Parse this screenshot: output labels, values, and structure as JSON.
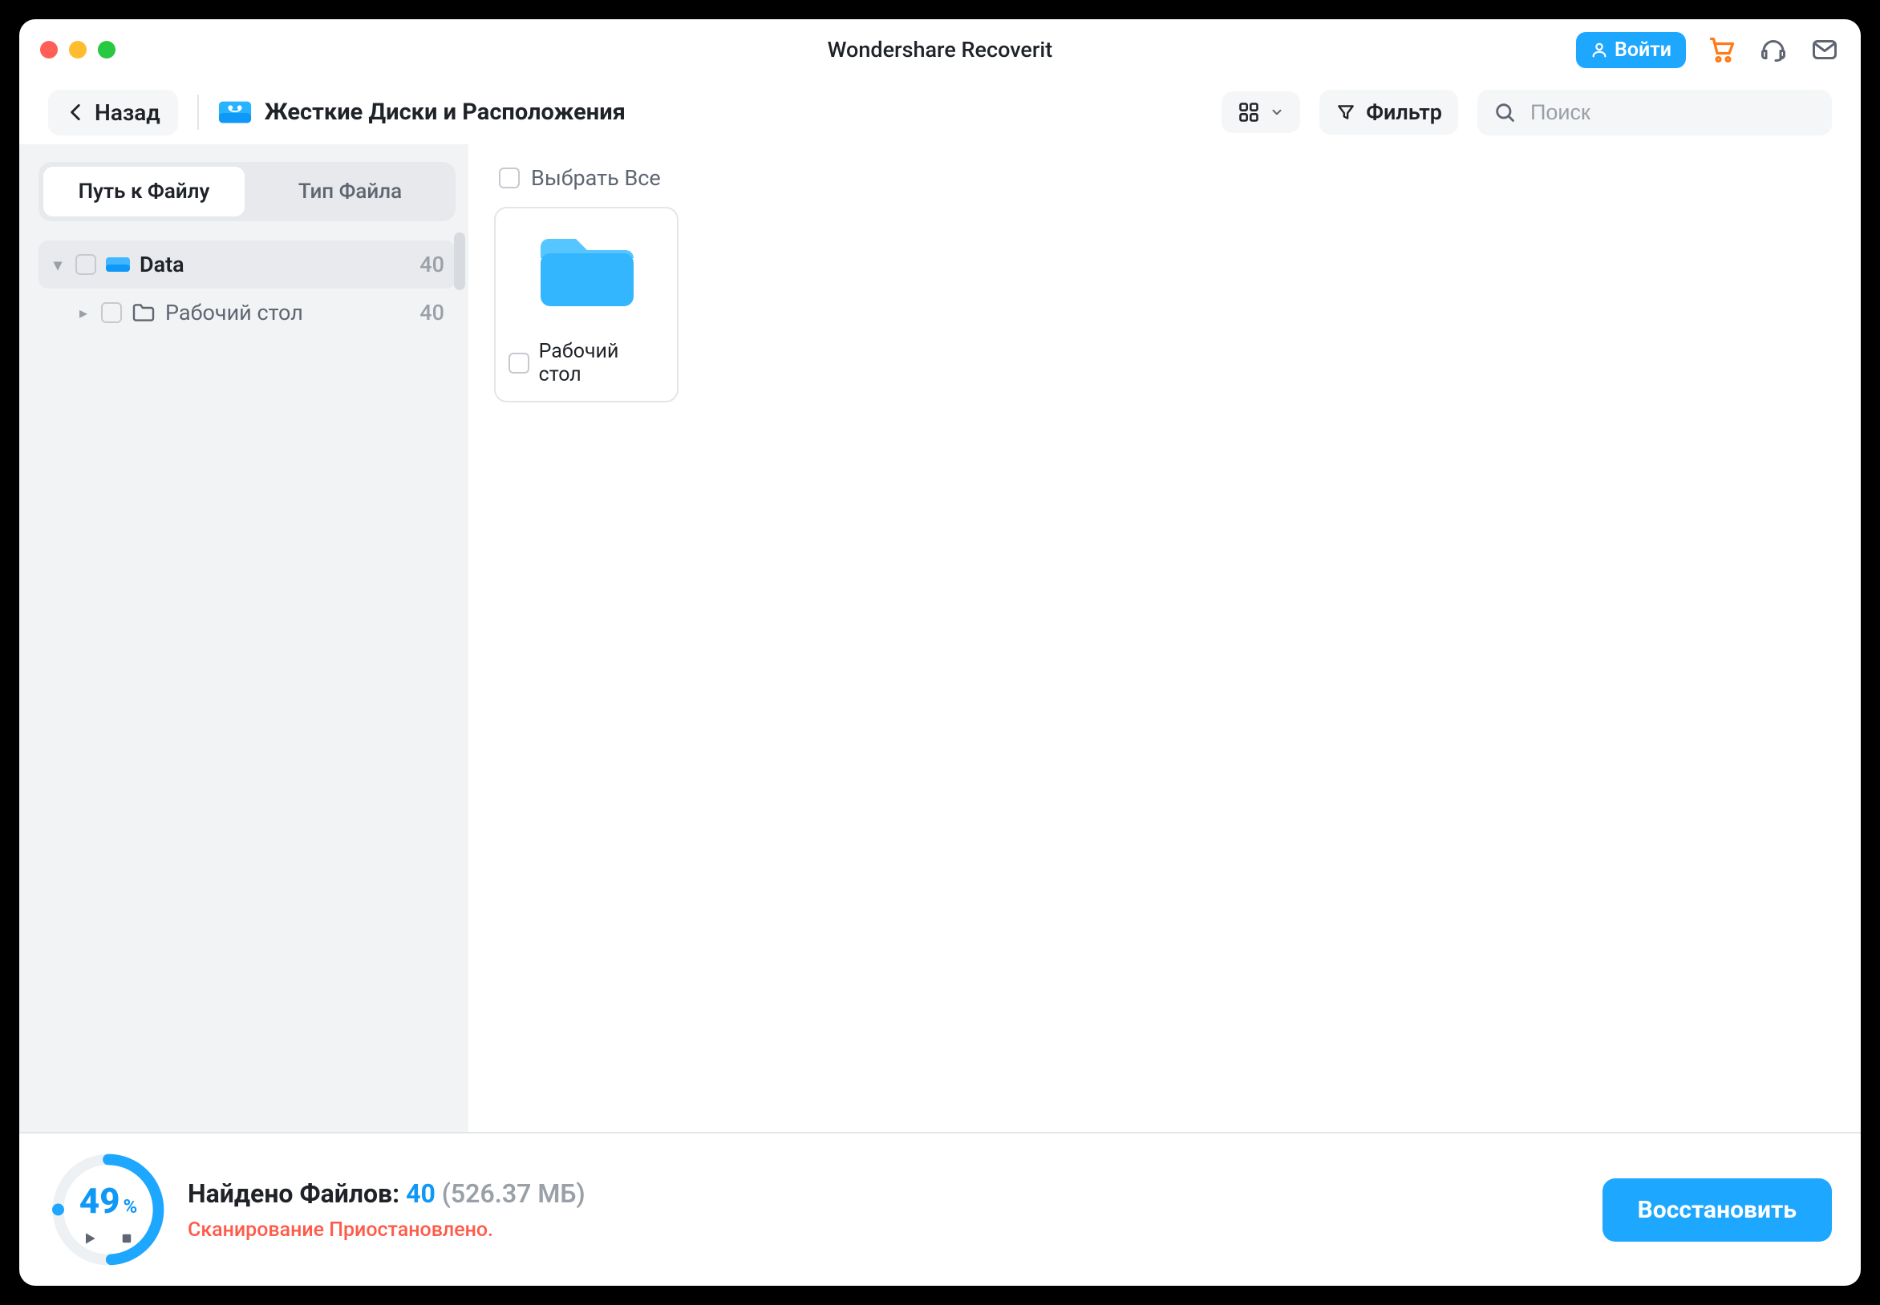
{
  "window": {
    "title": "Wondershare Recoverit"
  },
  "titlebar": {
    "login": "Войти"
  },
  "toolbar": {
    "back": "Назад",
    "location_title": "Жесткие Диски и Расположения",
    "filter": "Фильтр",
    "search_placeholder": "Поиск"
  },
  "sidebar": {
    "tabs": {
      "by_path": "Путь к Файлу",
      "by_type": "Тип Файла"
    },
    "tree": [
      {
        "label": "Data",
        "count": "40",
        "level": 1,
        "active": true,
        "icon": "disk"
      },
      {
        "label": "Рабочий стол",
        "count": "40",
        "level": 2,
        "active": false,
        "icon": "folder-outline"
      }
    ]
  },
  "content": {
    "select_all": "Выбрать Все",
    "items": [
      {
        "label": "Рабочий стол"
      }
    ]
  },
  "bottom": {
    "progress_percent": 49,
    "progress_unit": "%",
    "found_prefix": "Найдено Файлов:",
    "found_count": "40",
    "found_size": "(526.37 МБ)",
    "status": "Сканирование Приостановлено.",
    "recover": "Восстановить"
  }
}
